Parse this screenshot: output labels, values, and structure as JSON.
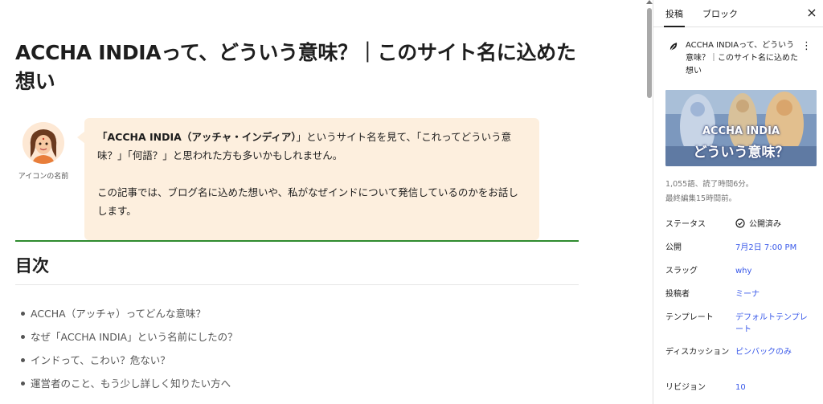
{
  "post": {
    "title": "ACCHA INDIAって、どういう意味？｜このサイト名に込めた想い"
  },
  "speech": {
    "avatar_name": "アイコンの名前",
    "para1_bold": "「ACCHA INDIA（アッチャ・インディア）",
    "para1_rest": "」というサイト名を見て、「これってどういう意味？」「何語？」と思われた方も多いかもしれません。",
    "para2": "この記事では、ブログ名に込めた想いや、私がなぜインドについて発信しているのかをお話しします。"
  },
  "toc": {
    "heading": "目次",
    "items": [
      "ACCHA（アッチャ）ってどんな意味？",
      "なぜ「ACCHA INDIA」という名前にしたの？",
      "インドって、こわい？危ない？",
      "運営者のこと、もう少し詳しく知りたい方へ"
    ]
  },
  "sidebar": {
    "tabs": [
      "投稿",
      "ブロック"
    ],
    "close_label": "×",
    "card_title": "ACCHA INDIAって、どういう意味？｜このサイト名に込めた想い",
    "more_label": "⋮",
    "thumbnail_line1": "ACCHA INDIA",
    "thumbnail_line2": "どういう意味？",
    "word_count": "1,055語、読了時間6分。",
    "last_edited": "最終編集15時間前。",
    "properties": {
      "status_label": "ステータス",
      "status_value": "公開済み",
      "publish_label": "公開",
      "publish_value": "7月2日 7:00 PM",
      "slug_label": "スラッグ",
      "slug_value": "why",
      "author_label": "投稿者",
      "author_value": "ミーナ",
      "template_label": "テンプレート",
      "template_value": "デフォルトテンプレート",
      "discussion_label": "ディスカッション",
      "discussion_value": "ピンバックのみ",
      "revisions_label": "リビジョン",
      "revisions_value": "10"
    }
  },
  "colors": {
    "accent": "#3858e9",
    "bubble": "#fdefde",
    "toc_line": "#2e8b2e"
  },
  "icons": {
    "leaf": "leaf-icon",
    "more": "more-vertical-icon",
    "close": "close-icon",
    "status": "check-circle-icon"
  }
}
